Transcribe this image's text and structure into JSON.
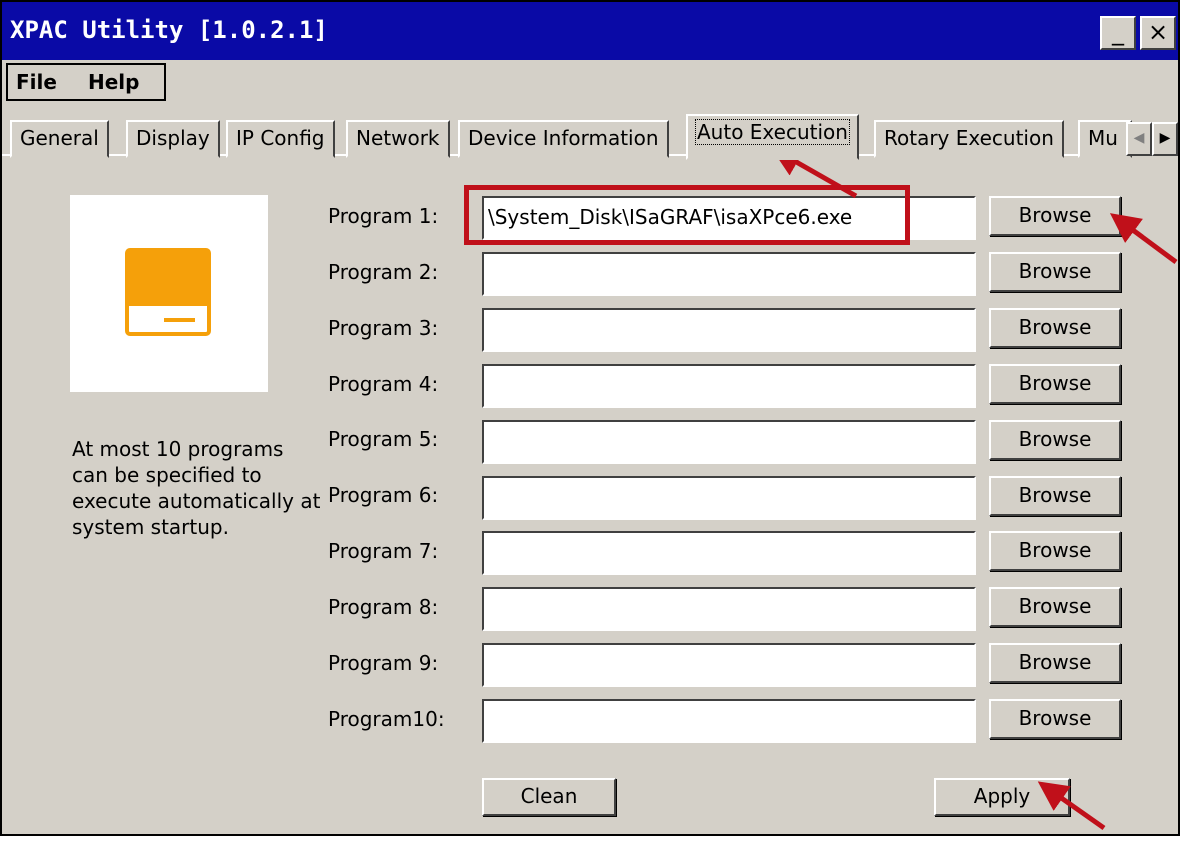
{
  "window": {
    "title": "XPAC Utility [1.0.2.1]",
    "minimize_label": "_",
    "close_label": "×"
  },
  "menu": {
    "items": [
      {
        "label": "File"
      },
      {
        "label": "Help"
      }
    ]
  },
  "tabs": [
    {
      "label": "General"
    },
    {
      "label": "Display"
    },
    {
      "label": "IP Config"
    },
    {
      "label": "Network"
    },
    {
      "label": "Device Information"
    },
    {
      "label": "Auto Execution",
      "active": true
    },
    {
      "label": "Rotary Execution"
    },
    {
      "label": "Mu"
    }
  ],
  "tab_scroll": {
    "left_icon": "◀",
    "right_icon": "▶"
  },
  "description": "At most 10 programs can be specified to execute automatically at system startup.",
  "programs": [
    {
      "label": "Program 1:",
      "value": "\\System_Disk\\ISaGRAF\\isaXPce6.exe",
      "browse": "Browse"
    },
    {
      "label": "Program 2:",
      "value": "",
      "browse": "Browse"
    },
    {
      "label": "Program 3:",
      "value": "",
      "browse": "Browse"
    },
    {
      "label": "Program 4:",
      "value": "",
      "browse": "Browse"
    },
    {
      "label": "Program 5:",
      "value": "",
      "browse": "Browse"
    },
    {
      "label": "Program 6:",
      "value": "",
      "browse": "Browse"
    },
    {
      "label": "Program 7:",
      "value": "",
      "browse": "Browse"
    },
    {
      "label": "Program 8:",
      "value": "",
      "browse": "Browse"
    },
    {
      "label": "Program 9:",
      "value": "",
      "browse": "Browse"
    },
    {
      "label": "Program10:",
      "value": "",
      "browse": "Browse"
    }
  ],
  "actions": {
    "clean": "Clean",
    "apply": "Apply"
  },
  "colors": {
    "titlebar": "#0a0aa6",
    "face": "#d4d0c8",
    "icon_orange": "#f5a00a",
    "annotation_red": "#c0101a"
  },
  "icons": {
    "app_icon": "computer-monitor-icon",
    "annotations": "red-arrow-icon"
  }
}
